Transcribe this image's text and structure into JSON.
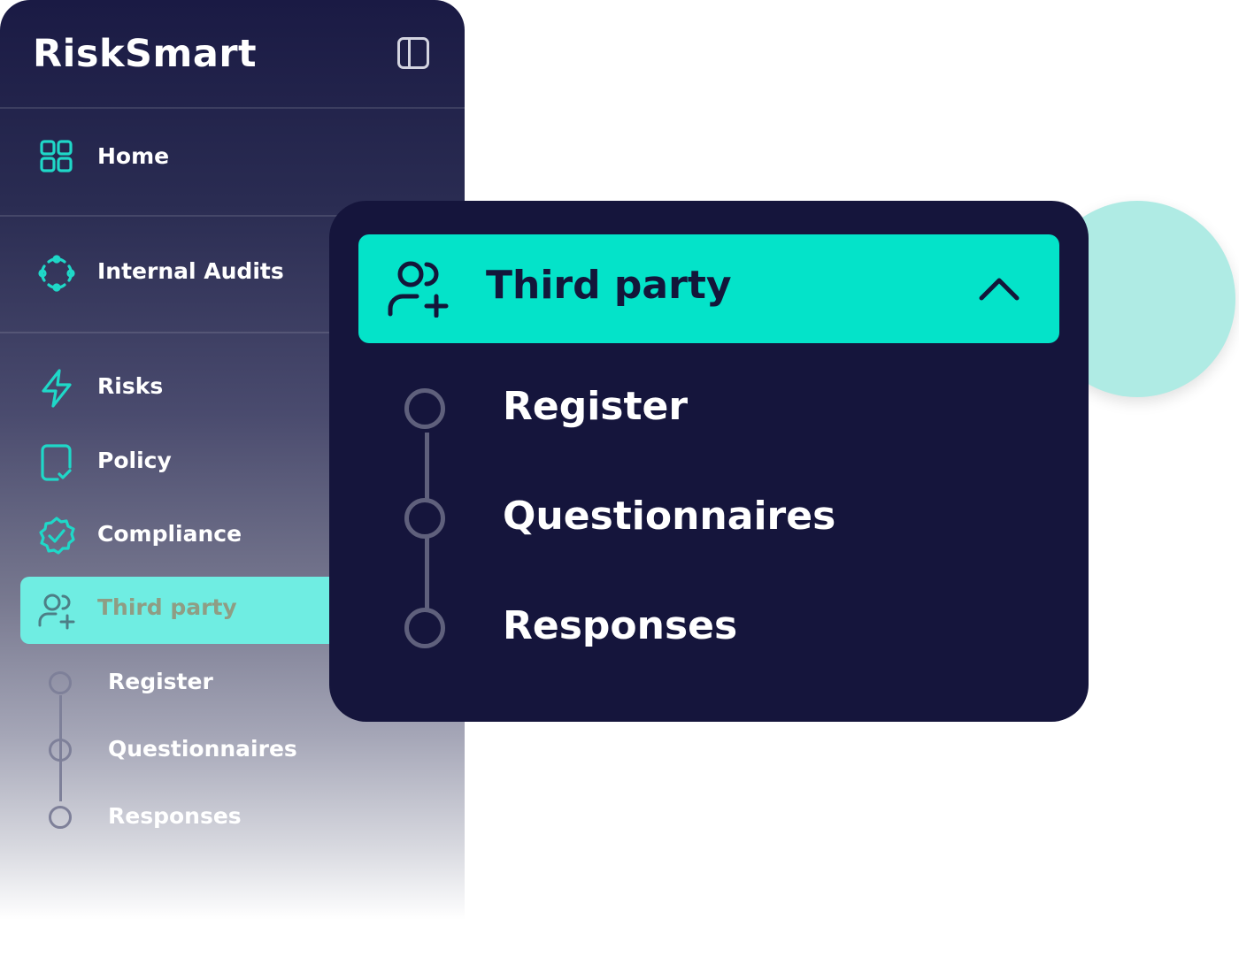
{
  "brand": {
    "name": "RiskSmart"
  },
  "sidebar": {
    "items": [
      {
        "label": "Home",
        "icon": "grid-icon"
      },
      {
        "label": "Internal Audits",
        "icon": "audit-cycle-icon"
      },
      {
        "label": "Risks",
        "icon": "lightning-icon"
      },
      {
        "label": "Policy",
        "icon": "policy-document-icon"
      },
      {
        "label": "Compliance",
        "icon": "check-badge-icon"
      },
      {
        "label": "Third party",
        "icon": "user-add-icon",
        "active": true
      }
    ],
    "subitems": [
      "Register",
      "Questionnaires",
      "Responses"
    ]
  },
  "panel": {
    "title": "Third party",
    "icon": "user-add-icon",
    "toggle_icon": "chevron-up-icon",
    "subitems": [
      "Register",
      "Questionnaires",
      "Responses"
    ]
  },
  "colors": {
    "accent": "#04e3c9",
    "active_bg": "#6fede2",
    "panel_bg": "#15153c",
    "sidebar_top": "#1a1a44"
  }
}
